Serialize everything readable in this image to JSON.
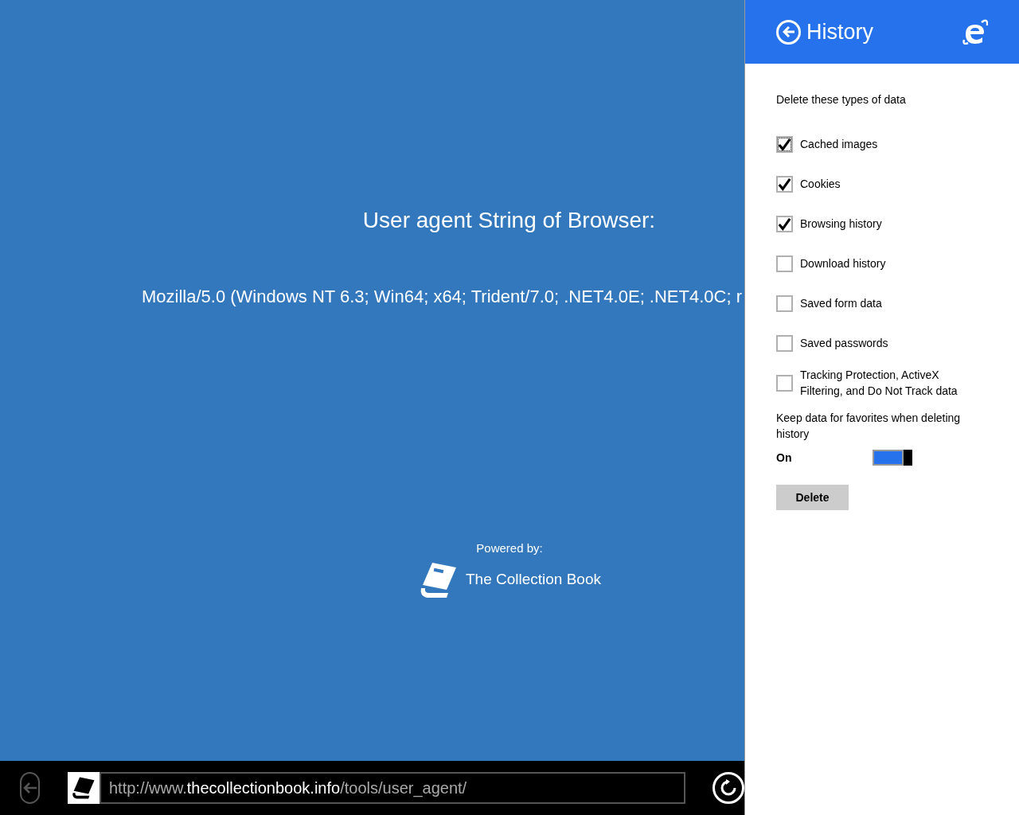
{
  "page": {
    "heading": "User agent String of Browser:",
    "user_agent": "Mozilla/5.0 (Windows NT 6.3; Win64; x64; Trident/7.0; .NET4.0E; .NET4.0C; r",
    "powered_by": "Powered by:",
    "brand": "The Collection Book"
  },
  "address_bar": {
    "url": "http://www.**thecollectionbook.info**/tools/user_agent/"
  },
  "panel": {
    "title": "History",
    "section_label": "Delete these types of data",
    "options": [
      {
        "label": "Cached images",
        "checked": true,
        "focused": true
      },
      {
        "label": "Cookies",
        "checked": true,
        "focused": false
      },
      {
        "label": "Browsing history",
        "checked": true,
        "focused": false
      },
      {
        "label": "Download history",
        "checked": false,
        "focused": false
      },
      {
        "label": "Saved form data",
        "checked": false,
        "focused": false
      },
      {
        "label": "Saved passwords",
        "checked": false,
        "focused": false
      },
      {
        "label": "Tracking Protection, ActiveX Filtering, and Do Not Track data",
        "checked": false,
        "focused": false
      }
    ],
    "toggle": {
      "label": "Keep data for favorites when deleting history",
      "state_text": "On",
      "on": true
    },
    "delete_button": "Delete"
  }
}
